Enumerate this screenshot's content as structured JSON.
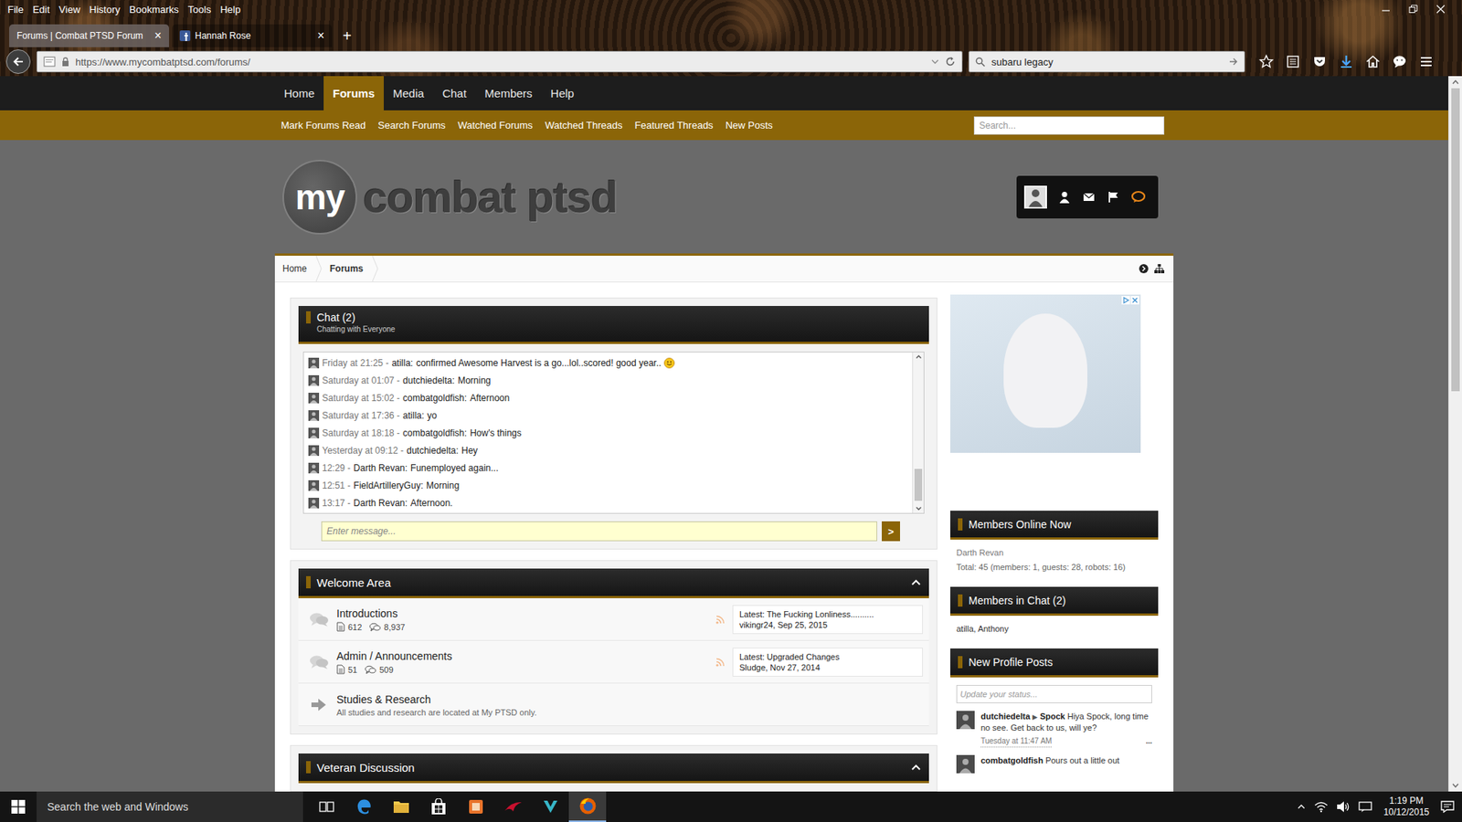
{
  "browser": {
    "menu": [
      "File",
      "Edit",
      "View",
      "History",
      "Bookmarks",
      "Tools",
      "Help"
    ],
    "tabs": [
      {
        "label": "Forums | Combat PTSD Forum",
        "selected": true,
        "close": "×",
        "kind": "plain"
      },
      {
        "label": "Hannah Rose",
        "selected": false,
        "close": "×",
        "kind": "facebook"
      }
    ],
    "new_tab": "+",
    "url": "https://www.mycombatptsd.com/forums/",
    "search": "subaru legacy"
  },
  "site": {
    "nav": [
      {
        "label": "Home",
        "selected": false
      },
      {
        "label": "Forums",
        "selected": true
      },
      {
        "label": "Media",
        "selected": false
      },
      {
        "label": "Chat",
        "selected": false
      },
      {
        "label": "Members",
        "selected": false
      },
      {
        "label": "Help",
        "selected": false
      }
    ],
    "subnav": [
      "Mark Forums Read",
      "Search Forums",
      "Watched Forums",
      "Watched Threads",
      "Featured Threads",
      "New Posts"
    ],
    "search_placeholder": "Search...",
    "logo": {
      "badge": "my",
      "name": "combat ptsd"
    },
    "breadcrumb": [
      {
        "label": "Home",
        "current": false
      },
      {
        "label": "Forums",
        "current": true
      }
    ]
  },
  "chat": {
    "title": "Chat (2)",
    "subtitle": "Chatting with Everyone",
    "messages": [
      {
        "time": "Friday at 21:25 -",
        "author": "atilla:",
        "text": "confirmed Awesome Harvest is a go...lol..scored! good year..",
        "emoji": true
      },
      {
        "time": "Saturday at 01:07 -",
        "author": "dutchiedelta:",
        "text": "Morning",
        "emoji": false
      },
      {
        "time": "Saturday at 15:02 -",
        "author": "combatgoldfish:",
        "text": "Afternoon",
        "emoji": false
      },
      {
        "time": "Saturday at 17:36 -",
        "author": "atilla:",
        "text": "yo",
        "emoji": false
      },
      {
        "time": "Saturday at 18:18 -",
        "author": "combatgoldfish:",
        "text": "How's things",
        "emoji": false
      },
      {
        "time": "Yesterday at 09:12 -",
        "author": "dutchiedelta:",
        "text": "Hey",
        "emoji": false
      },
      {
        "time": "12:29 -",
        "author": "Darth Revan:",
        "text": "Funemployed again...",
        "emoji": false
      },
      {
        "time": "12:51 -",
        "author": "FieldArtilleryGuy:",
        "text": "Morning",
        "emoji": false
      },
      {
        "time": "13:17 -",
        "author": "Darth Revan:",
        "text": "Afternoon.",
        "emoji": false
      }
    ],
    "input_placeholder": "Enter message...",
    "send": ">"
  },
  "categories": [
    {
      "title": "Welcome Area",
      "expanded": true,
      "forums": [
        {
          "kind": "forum",
          "name": "Introductions",
          "threads": "612",
          "posts": "8,937",
          "latest_title": "Latest: The Fucking Lonliness..........",
          "latest_meta": "vikingr24, Sep 25, 2015"
        },
        {
          "kind": "forum",
          "name": "Admin / Announcements",
          "threads": "51",
          "posts": "509",
          "latest_title": "Latest: Upgraded Changes",
          "latest_meta": "Sludge, Nov 27, 2014"
        },
        {
          "kind": "link",
          "name": "Studies & Research",
          "description": "All studies and research are located at My PTSD only."
        }
      ]
    },
    {
      "title": "Veteran Discussion",
      "expanded": true,
      "forums": []
    }
  ],
  "sidebar": {
    "online": {
      "title": "Members Online Now",
      "members": [
        "Darth Revan"
      ],
      "total": "Total: 45 (members: 1, guests: 28, robots: 16)"
    },
    "in_chat": {
      "title": "Members in Chat (2)",
      "members": "atilla, Anthony"
    },
    "profile_posts": {
      "title": "New Profile Posts",
      "placeholder": "Update your status...",
      "posts": [
        {
          "author": "dutchiedelta",
          "arrow": "▶",
          "target": "Spock",
          "text": "Hiya Spock, long time no see. Get back to us, will ye?",
          "time": "Tuesday at 11:47 AM",
          "more": "..."
        },
        {
          "author": "combatgoldfish",
          "text": "Pours out a little out"
        }
      ]
    }
  },
  "taskbar": {
    "search_placeholder": "Search the web and Windows",
    "time": "1:19 PM",
    "date": "10/12/2015"
  }
}
